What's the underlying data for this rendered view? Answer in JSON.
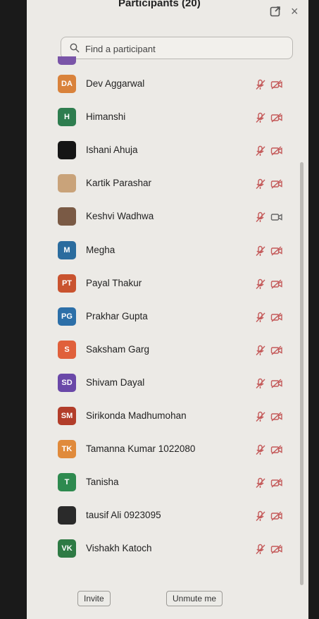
{
  "header": {
    "title": "Participants (20)"
  },
  "search": {
    "placeholder": "Find a participant"
  },
  "participants": [
    {
      "initials": "DA",
      "name": "Dev Aggarwal",
      "color": "#d9823b",
      "cam": "off"
    },
    {
      "initials": "H",
      "name": "Himanshi",
      "color": "#2e7d4f",
      "cam": "off"
    },
    {
      "initials": "",
      "name": "Ishani Ahuja",
      "color": "#151515",
      "cam": "off"
    },
    {
      "initials": "",
      "name": "Kartik Parashar",
      "color": "#c9a37a",
      "cam": "off"
    },
    {
      "initials": "",
      "name": "Keshvi Wadhwa",
      "color": "#7a5a45",
      "cam": "on"
    },
    {
      "initials": "M",
      "name": "Megha",
      "color": "#2b6c9e",
      "cam": "off"
    },
    {
      "initials": "PT",
      "name": "Payal Thakur",
      "color": "#c9532f",
      "cam": "off"
    },
    {
      "initials": "PG",
      "name": "Prakhar Gupta",
      "color": "#2c6fa8",
      "cam": "off"
    },
    {
      "initials": "S",
      "name": "Saksham Garg",
      "color": "#e0603b",
      "cam": "off"
    },
    {
      "initials": "SD",
      "name": "Shivam Dayal",
      "color": "#6a48a8",
      "cam": "off"
    },
    {
      "initials": "SM",
      "name": "Sirikonda Madhumohan",
      "color": "#b23d2a",
      "cam": "off"
    },
    {
      "initials": "TK",
      "name": "Tamanna Kumar 1022080",
      "color": "#e08a3b",
      "cam": "off"
    },
    {
      "initials": "T",
      "name": "Tanisha",
      "color": "#2e8a4f",
      "cam": "off"
    },
    {
      "initials": "",
      "name": "tausif Ali 0923095",
      "color": "#2a2a2a",
      "cam": "off"
    },
    {
      "initials": "VK",
      "name": "Vishakh Katoch",
      "color": "#2e7a44",
      "cam": "off"
    }
  ],
  "footer": {
    "invite_label": "Invite",
    "unmute_label": "Unmute me"
  },
  "colors": {
    "icon_muted": "#c45a5a",
    "panel_bg": "#eceae6"
  }
}
